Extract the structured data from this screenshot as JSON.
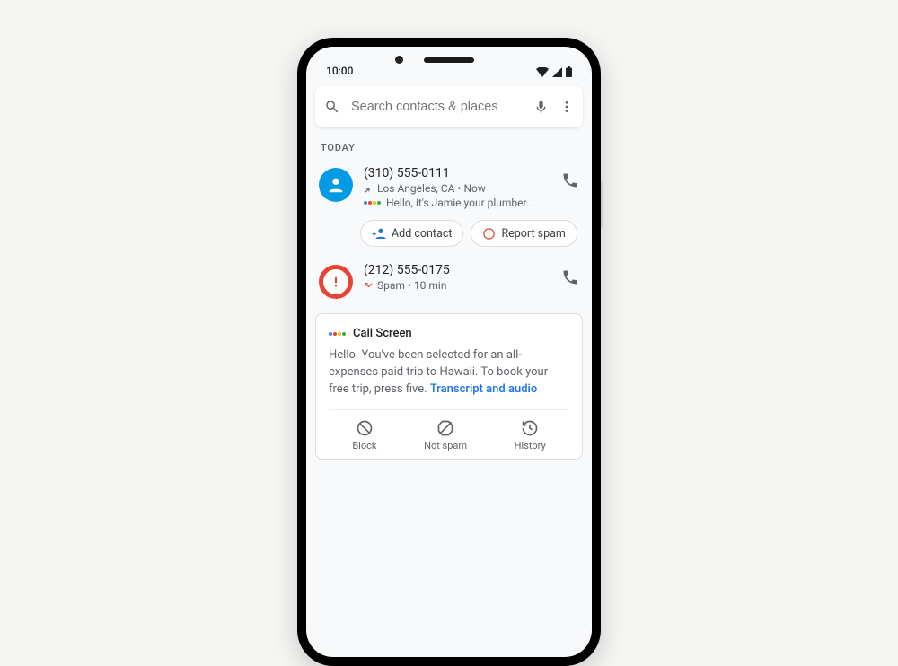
{
  "status": {
    "time": "10:00"
  },
  "search": {
    "placeholder": "Search contacts & places"
  },
  "section_label": "TODAY",
  "calls": [
    {
      "avatar": "blue",
      "number": "(310) 555-0111",
      "meta": "Los Angeles, CA • Now",
      "assistant_preview": "Hello, it's Jamie your plumber...",
      "chips": {
        "add_contact": "Add contact",
        "report_spam": "Report spam"
      }
    },
    {
      "avatar": "red",
      "number": "(212) 555-0175",
      "meta": "Spam • 10 min"
    }
  ],
  "call_screen": {
    "title": "Call Screen",
    "body": "Hello. You've been selected for an all-expenses paid trip to Hawaii. To book your free trip, press five.",
    "link": "Transcript and audio",
    "actions": {
      "block": "Block",
      "not_spam": "Not spam",
      "history": "History"
    }
  }
}
